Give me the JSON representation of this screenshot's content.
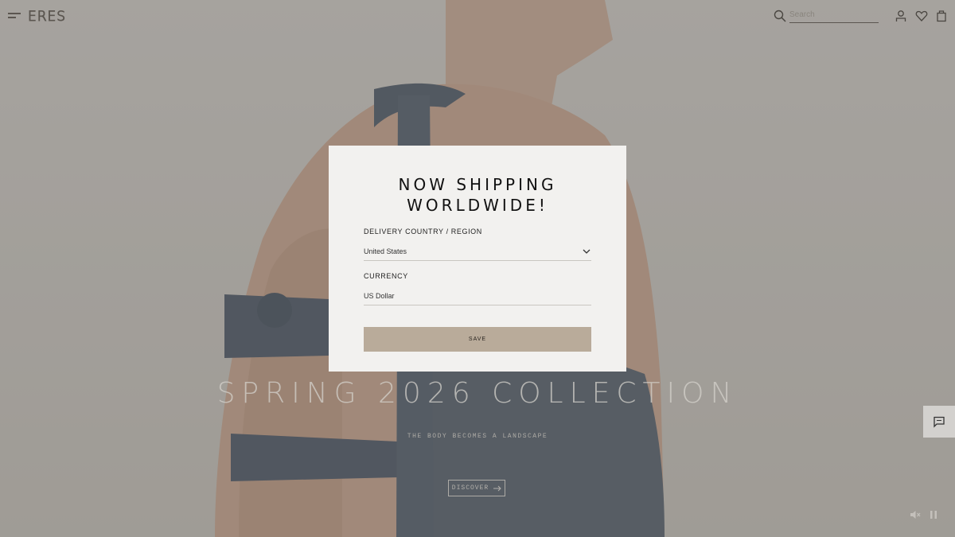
{
  "header": {
    "logo_text": "ERES",
    "search": {
      "placeholder": "Search",
      "value": ""
    },
    "icons": [
      "menu-icon",
      "search-icon",
      "account-icon",
      "wishlist-heart-icon",
      "bag-icon"
    ]
  },
  "hero": {
    "title": "SPRING 2026 COLLECTION",
    "subtitle": "THE BODY BECOMES A LANDSCAPE",
    "discover_label": "DISCOVER",
    "discover_icon": "arrow-right-icon"
  },
  "modal": {
    "title": "NOW SHIPPING\nWORLDWIDE!",
    "country_label": "DELIVERY COUNTRY / REGION",
    "country_value": "United States",
    "currency_label": "CURRENCY",
    "currency_value": "US Dollar",
    "save_label": "SAVE"
  },
  "widgets": {
    "chat_icon": "chat-bubble-icon",
    "mute_icon": "speaker-mute-icon",
    "pause_icon": "pause-icon"
  },
  "colors": {
    "modal_background": "#f2f1ef",
    "save_button": "#b9ab9a",
    "overlay": "rgba(110,110,110,0.42)"
  }
}
